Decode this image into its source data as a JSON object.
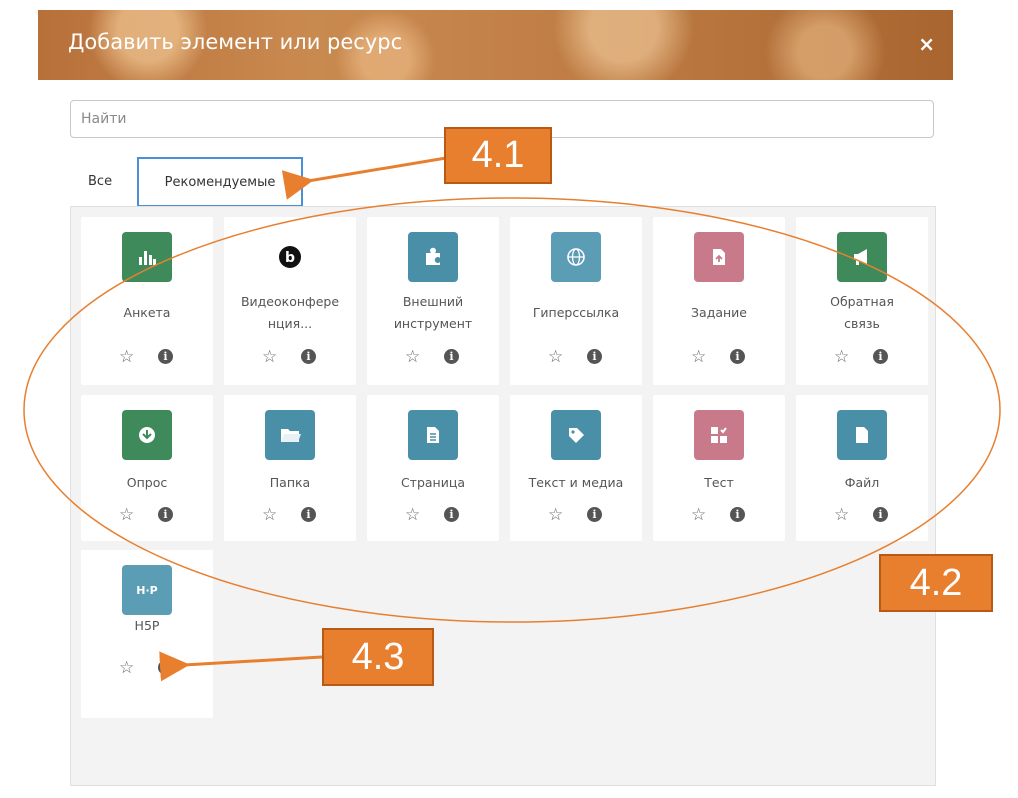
{
  "dialog": {
    "title": "Добавить элемент или ресурс",
    "close_symbol": "×"
  },
  "search": {
    "placeholder": "Найти"
  },
  "tabs": [
    {
      "label": "Все"
    },
    {
      "label": "Рекомендуемые",
      "selected": true
    }
  ],
  "modules": [
    {
      "label": "Анкета",
      "icon": "chart-icon",
      "color": "#3e8a5a",
      "glyph": "📊"
    },
    {
      "label": "Видеоконфере\nнция...",
      "icon": "bigbluebutton-icon",
      "color": "#ffffff",
      "glyph": "b"
    },
    {
      "label": "Внешний\nинструмент",
      "icon": "puzzle-icon",
      "color": "#4a8fa8",
      "glyph": "✚"
    },
    {
      "label": "Гиперссылка",
      "icon": "globe-icon",
      "color": "#5a9db5",
      "glyph": "◎"
    },
    {
      "label": "Задание",
      "icon": "assignment-icon",
      "color": "#c97a8a",
      "glyph": "🗎"
    },
    {
      "label": "Обратная\nсвязь",
      "icon": "megaphone-icon",
      "color": "#3e8a5a",
      "glyph": "📢"
    },
    {
      "label": "Опрос",
      "icon": "choice-icon",
      "color": "#3e8a5a",
      "glyph": "⚇"
    },
    {
      "label": "Папка",
      "icon": "folder-icon",
      "color": "#4a8fa8",
      "glyph": "📂"
    },
    {
      "label": "Страница",
      "icon": "page-icon",
      "color": "#4a8fa8",
      "glyph": "🗏"
    },
    {
      "label": "Текст и медиа",
      "icon": "tag-icon",
      "color": "#4a8fa8",
      "glyph": "🏷"
    },
    {
      "label": "Тест",
      "icon": "quiz-icon",
      "color": "#c97a8a",
      "glyph": "▦"
    },
    {
      "label": "Файл",
      "icon": "file-icon",
      "color": "#4a8fa8",
      "glyph": "🗋"
    },
    {
      "label": "H5P",
      "icon": "h5p-icon",
      "color": "#5a9db5",
      "glyph": "H·P"
    }
  ],
  "card_actions": {
    "star": "☆",
    "info": "i"
  },
  "callouts": [
    {
      "text": "4.1"
    },
    {
      "text": "4.2"
    },
    {
      "text": "4.3"
    }
  ],
  "colors": {
    "callout": "#e87f2f",
    "arrow": "#e87f2f",
    "tab_highlight": "#4a90d9"
  }
}
